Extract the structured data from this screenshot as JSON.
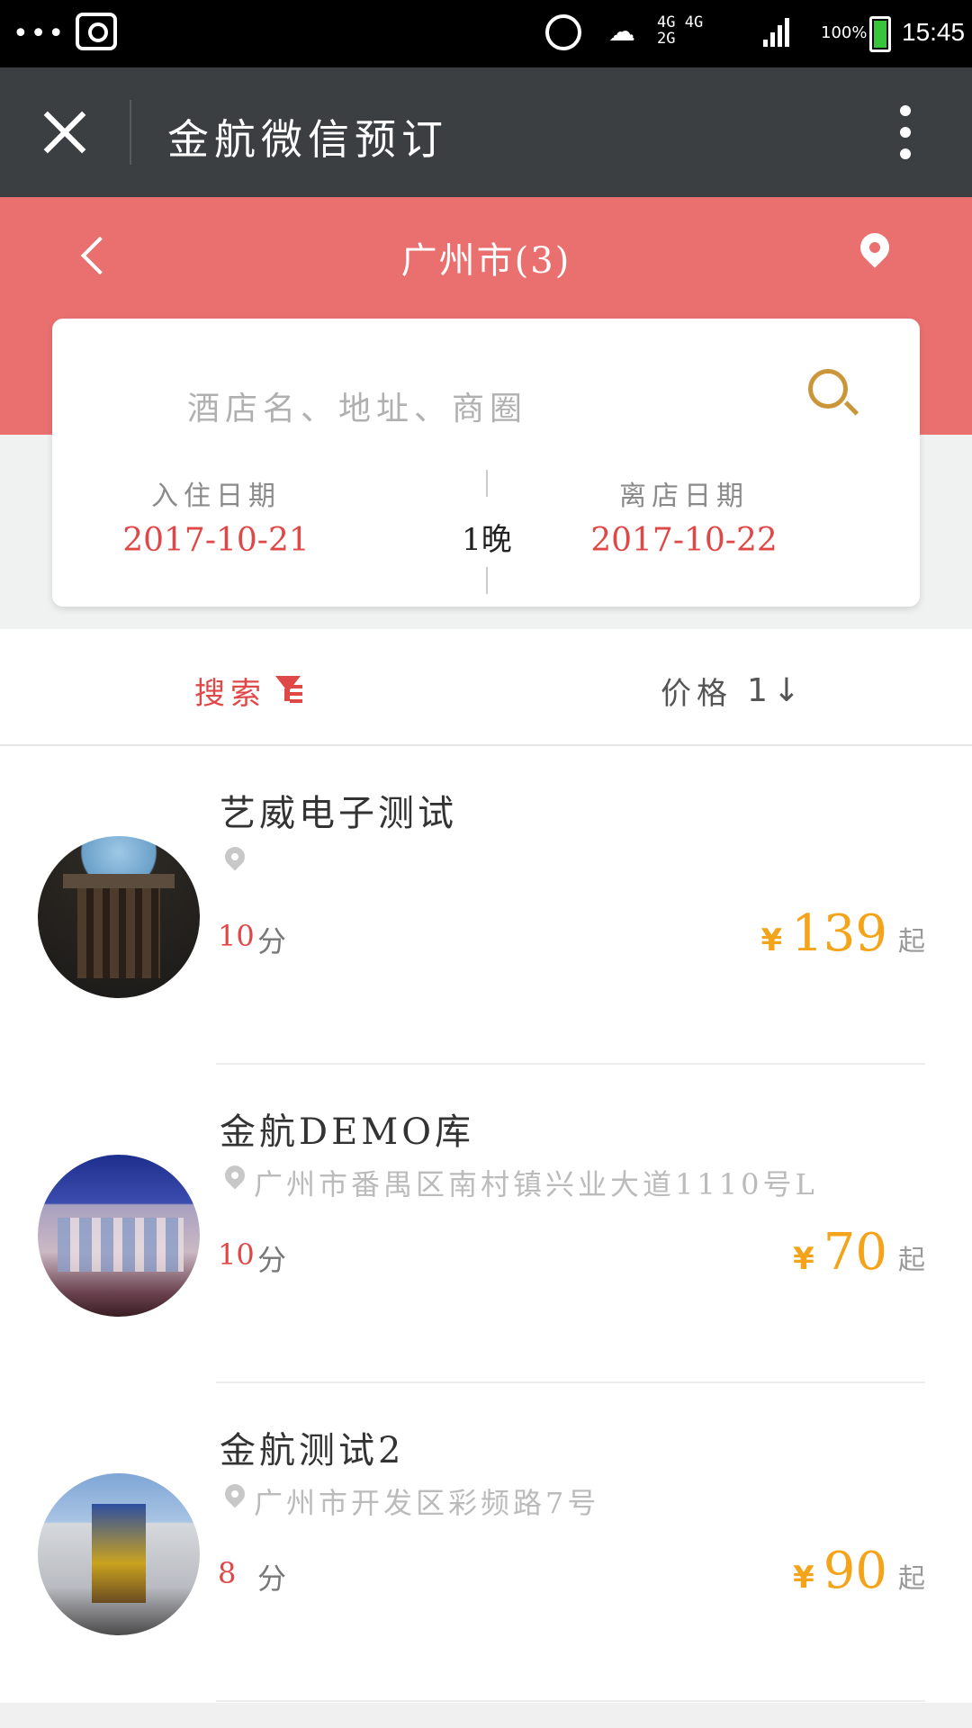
{
  "status_bar": {
    "dots": "•••",
    "network": "4G 4G\n2G",
    "signal_label": "G",
    "battery_percent": "100%",
    "time": "15:45",
    "icons": [
      "screenshot-icon",
      "alarm-icon",
      "weather-icon",
      "signal-icon",
      "battery-icon"
    ]
  },
  "titlebar": {
    "title": "金航微信预订",
    "close_icon": "close-icon",
    "more_icon": "more-vertical-icon"
  },
  "header": {
    "city": "广州市(3)",
    "back_icon": "chevron-left-icon",
    "location_icon": "location-pin-icon",
    "bg_color": "#ea7070"
  },
  "search": {
    "placeholder": "酒店名、地址、商圈",
    "checkin_label": "入住日期",
    "checkin_date": "2017-10-21",
    "nights": "1晚",
    "checkout_label": "离店日期",
    "checkout_date": "2017-10-22"
  },
  "filters": {
    "search_label": "搜索",
    "price_label": "价格",
    "sort_icon": "1↓"
  },
  "hotels": [
    {
      "name": "艺威电子测试",
      "address": "",
      "score": "10",
      "score_unit": "分",
      "currency": "¥",
      "price": "139",
      "price_suffix": "起"
    },
    {
      "name": "金航DEMO库",
      "address": "广州市番禺区南村镇兴业大道1110号L",
      "score": "10",
      "score_unit": "分",
      "currency": "¥",
      "price": "70",
      "price_suffix": "起"
    },
    {
      "name": "金航测试2",
      "address": "广州市开发区彩频路7号",
      "score": "8",
      "score_unit": "分",
      "currency": "¥",
      "price": "90",
      "price_suffix": "起"
    }
  ],
  "colors": {
    "accent_red": "#e04848",
    "price_orange": "#f4a41a",
    "search_gold": "#c9963a",
    "titlebar": "#3b3f42"
  }
}
